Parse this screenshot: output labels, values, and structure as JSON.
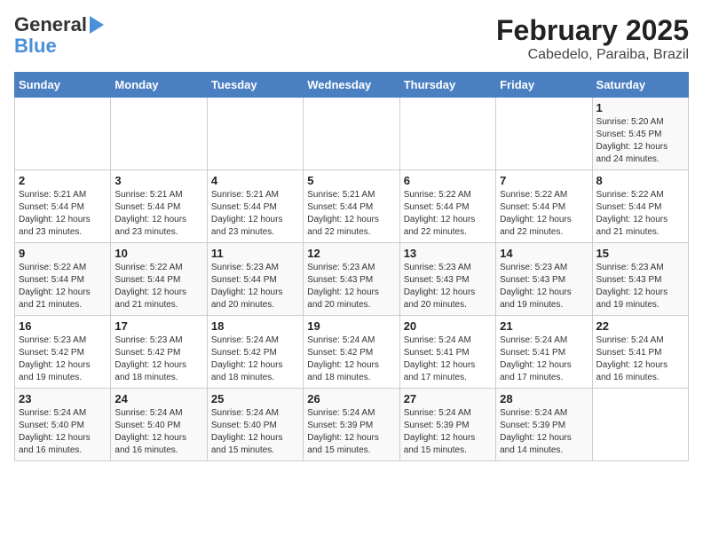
{
  "logo": {
    "line1": "General",
    "line2": "Blue"
  },
  "title": "February 2025",
  "subtitle": "Cabedelo, Paraiba, Brazil",
  "days_of_week": [
    "Sunday",
    "Monday",
    "Tuesday",
    "Wednesday",
    "Thursday",
    "Friday",
    "Saturday"
  ],
  "weeks": [
    [
      {
        "day": "",
        "info": ""
      },
      {
        "day": "",
        "info": ""
      },
      {
        "day": "",
        "info": ""
      },
      {
        "day": "",
        "info": ""
      },
      {
        "day": "",
        "info": ""
      },
      {
        "day": "",
        "info": ""
      },
      {
        "day": "1",
        "info": "Sunrise: 5:20 AM\nSunset: 5:45 PM\nDaylight: 12 hours\nand 24 minutes."
      }
    ],
    [
      {
        "day": "2",
        "info": "Sunrise: 5:21 AM\nSunset: 5:44 PM\nDaylight: 12 hours\nand 23 minutes."
      },
      {
        "day": "3",
        "info": "Sunrise: 5:21 AM\nSunset: 5:44 PM\nDaylight: 12 hours\nand 23 minutes."
      },
      {
        "day": "4",
        "info": "Sunrise: 5:21 AM\nSunset: 5:44 PM\nDaylight: 12 hours\nand 23 minutes."
      },
      {
        "day": "5",
        "info": "Sunrise: 5:21 AM\nSunset: 5:44 PM\nDaylight: 12 hours\nand 22 minutes."
      },
      {
        "day": "6",
        "info": "Sunrise: 5:22 AM\nSunset: 5:44 PM\nDaylight: 12 hours\nand 22 minutes."
      },
      {
        "day": "7",
        "info": "Sunrise: 5:22 AM\nSunset: 5:44 PM\nDaylight: 12 hours\nand 22 minutes."
      },
      {
        "day": "8",
        "info": "Sunrise: 5:22 AM\nSunset: 5:44 PM\nDaylight: 12 hours\nand 21 minutes."
      }
    ],
    [
      {
        "day": "9",
        "info": "Sunrise: 5:22 AM\nSunset: 5:44 PM\nDaylight: 12 hours\nand 21 minutes."
      },
      {
        "day": "10",
        "info": "Sunrise: 5:22 AM\nSunset: 5:44 PM\nDaylight: 12 hours\nand 21 minutes."
      },
      {
        "day": "11",
        "info": "Sunrise: 5:23 AM\nSunset: 5:44 PM\nDaylight: 12 hours\nand 20 minutes."
      },
      {
        "day": "12",
        "info": "Sunrise: 5:23 AM\nSunset: 5:43 PM\nDaylight: 12 hours\nand 20 minutes."
      },
      {
        "day": "13",
        "info": "Sunrise: 5:23 AM\nSunset: 5:43 PM\nDaylight: 12 hours\nand 20 minutes."
      },
      {
        "day": "14",
        "info": "Sunrise: 5:23 AM\nSunset: 5:43 PM\nDaylight: 12 hours\nand 19 minutes."
      },
      {
        "day": "15",
        "info": "Sunrise: 5:23 AM\nSunset: 5:43 PM\nDaylight: 12 hours\nand 19 minutes."
      }
    ],
    [
      {
        "day": "16",
        "info": "Sunrise: 5:23 AM\nSunset: 5:42 PM\nDaylight: 12 hours\nand 19 minutes."
      },
      {
        "day": "17",
        "info": "Sunrise: 5:23 AM\nSunset: 5:42 PM\nDaylight: 12 hours\nand 18 minutes."
      },
      {
        "day": "18",
        "info": "Sunrise: 5:24 AM\nSunset: 5:42 PM\nDaylight: 12 hours\nand 18 minutes."
      },
      {
        "day": "19",
        "info": "Sunrise: 5:24 AM\nSunset: 5:42 PM\nDaylight: 12 hours\nand 18 minutes."
      },
      {
        "day": "20",
        "info": "Sunrise: 5:24 AM\nSunset: 5:41 PM\nDaylight: 12 hours\nand 17 minutes."
      },
      {
        "day": "21",
        "info": "Sunrise: 5:24 AM\nSunset: 5:41 PM\nDaylight: 12 hours\nand 17 minutes."
      },
      {
        "day": "22",
        "info": "Sunrise: 5:24 AM\nSunset: 5:41 PM\nDaylight: 12 hours\nand 16 minutes."
      }
    ],
    [
      {
        "day": "23",
        "info": "Sunrise: 5:24 AM\nSunset: 5:40 PM\nDaylight: 12 hours\nand 16 minutes."
      },
      {
        "day": "24",
        "info": "Sunrise: 5:24 AM\nSunset: 5:40 PM\nDaylight: 12 hours\nand 16 minutes."
      },
      {
        "day": "25",
        "info": "Sunrise: 5:24 AM\nSunset: 5:40 PM\nDaylight: 12 hours\nand 15 minutes."
      },
      {
        "day": "26",
        "info": "Sunrise: 5:24 AM\nSunset: 5:39 PM\nDaylight: 12 hours\nand 15 minutes."
      },
      {
        "day": "27",
        "info": "Sunrise: 5:24 AM\nSunset: 5:39 PM\nDaylight: 12 hours\nand 15 minutes."
      },
      {
        "day": "28",
        "info": "Sunrise: 5:24 AM\nSunset: 5:39 PM\nDaylight: 12 hours\nand 14 minutes."
      },
      {
        "day": "",
        "info": ""
      }
    ]
  ]
}
